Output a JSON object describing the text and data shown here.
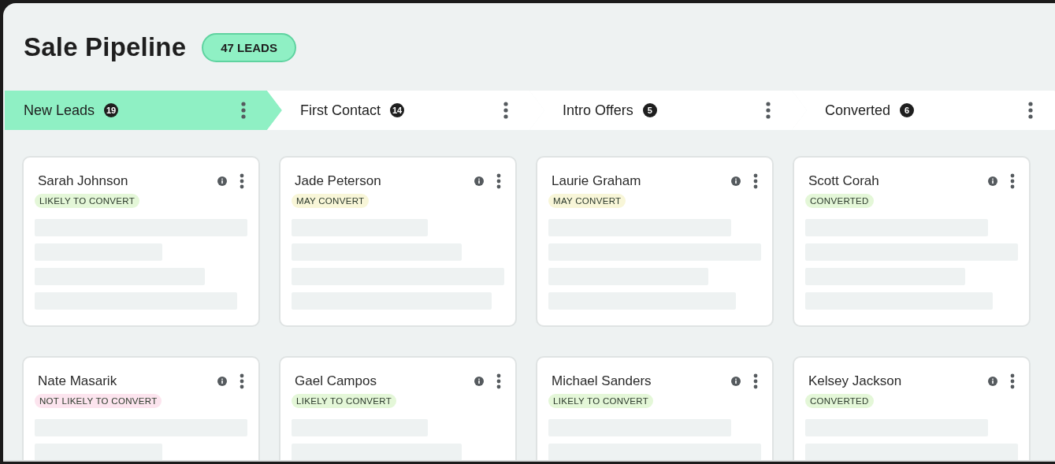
{
  "title": "Sale Pipeline",
  "lead_count": "47 LEADS",
  "stages": [
    {
      "label": "New Leads",
      "count": "19",
      "selected": true
    },
    {
      "label": "First Contact",
      "count": "14",
      "selected": false
    },
    {
      "label": "Intro Offers",
      "count": "5",
      "selected": false
    },
    {
      "label": "Converted",
      "count": "6",
      "selected": false
    }
  ],
  "columns": [
    {
      "cards": [
        {
          "name": "Sarah Johnson",
          "tag": "LIKELY TO CONVERT",
          "color": "#e4f7d8"
        },
        {
          "name": "Nate Masarik",
          "tag": "NOT LIKELY TO CONVERT",
          "color": "#fce4ee"
        }
      ]
    },
    {
      "cards": [
        {
          "name": "Jade Peterson",
          "tag": "MAY CONVERT",
          "color": "#f8f6d8"
        },
        {
          "name": "Gael Campos",
          "tag": "LIKELY TO CONVERT",
          "color": "#e4f7d8"
        }
      ]
    },
    {
      "cards": [
        {
          "name": "Laurie Graham",
          "tag": "MAY CONVERT",
          "color": "#f8f6d8"
        },
        {
          "name": "Michael Sanders",
          "tag": "LIKELY TO CONVERT",
          "color": "#e4f7d8"
        }
      ]
    },
    {
      "cards": [
        {
          "name": "Scott Corah",
          "tag": "CONVERTED",
          "color": "#e4f7d8"
        },
        {
          "name": "Kelsey Jackson",
          "tag": "CONVERTED",
          "color": "#e4f7d8"
        }
      ]
    }
  ]
}
